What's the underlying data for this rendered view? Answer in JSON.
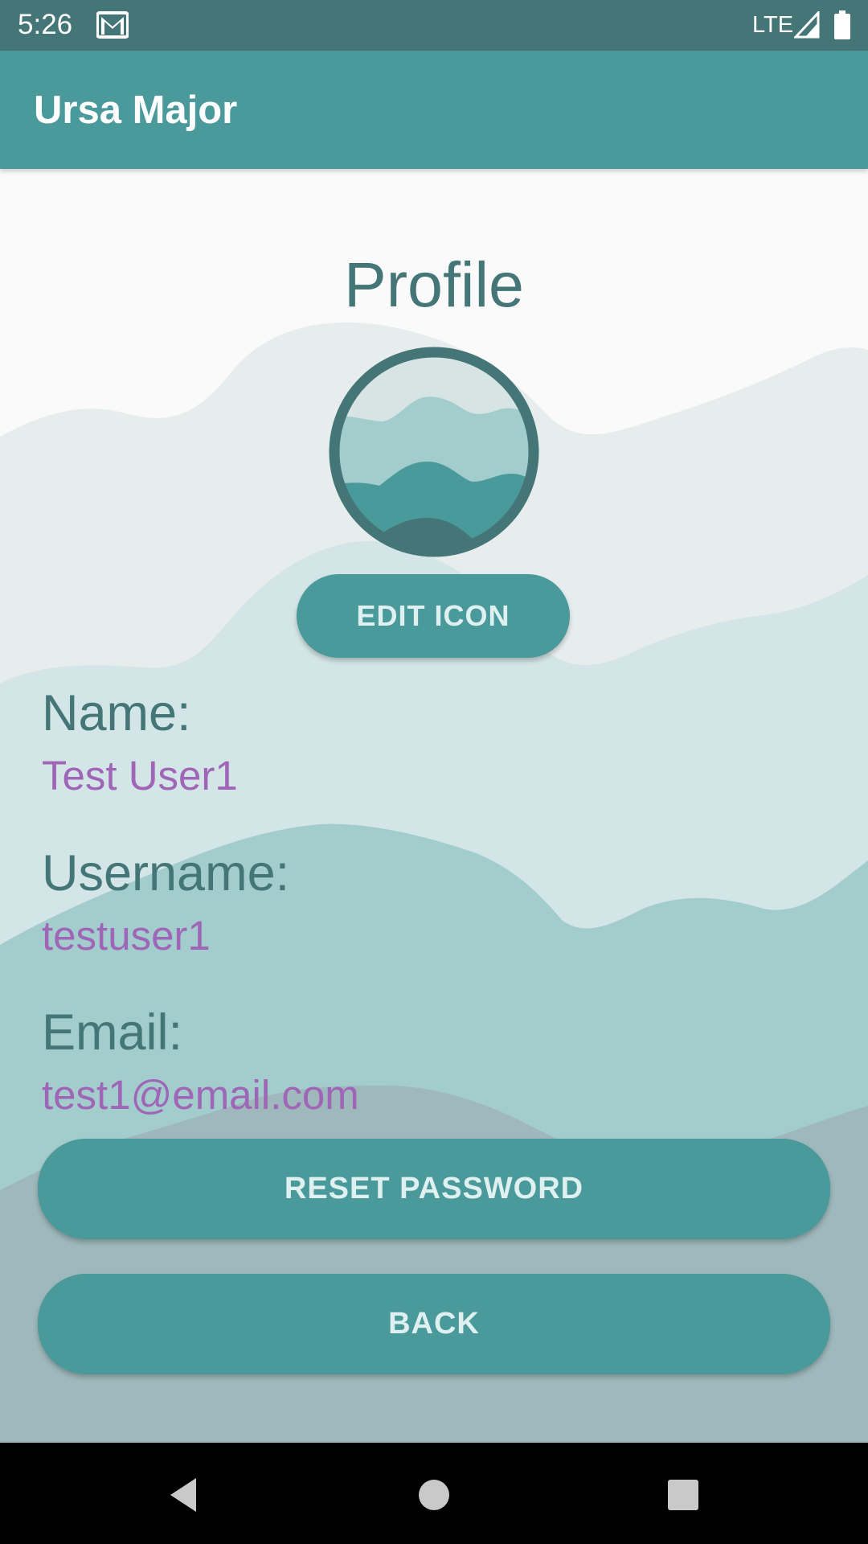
{
  "status_bar": {
    "time": "5:26",
    "network": "LTE",
    "icons": [
      "gmail-icon",
      "signal-icon",
      "battery-icon"
    ]
  },
  "app_bar": {
    "title": "Ursa Major"
  },
  "profile": {
    "title": "Profile",
    "avatar_icon": "mountain-avatar-icon",
    "edit_icon_label": "EDIT ICON",
    "fields": [
      {
        "label": "Name:",
        "value": "Test User1"
      },
      {
        "label": "Username:",
        "value": "testuser1"
      },
      {
        "label": "Email:",
        "value": "test1@email.com"
      }
    ],
    "reset_password_label": "RESET PASSWORD",
    "back_label": "BACK"
  },
  "nav_bar": {
    "icons": [
      "back-triangle-icon",
      "home-circle-icon",
      "recents-square-icon"
    ]
  },
  "colors": {
    "status_bar": "#447577",
    "app_bar": "#4a9a9c",
    "button": "#4a9a9c",
    "button_text": "#dff0f0",
    "label_text": "#447577",
    "value_text": "#9f65b6",
    "background": "#fafafa"
  }
}
